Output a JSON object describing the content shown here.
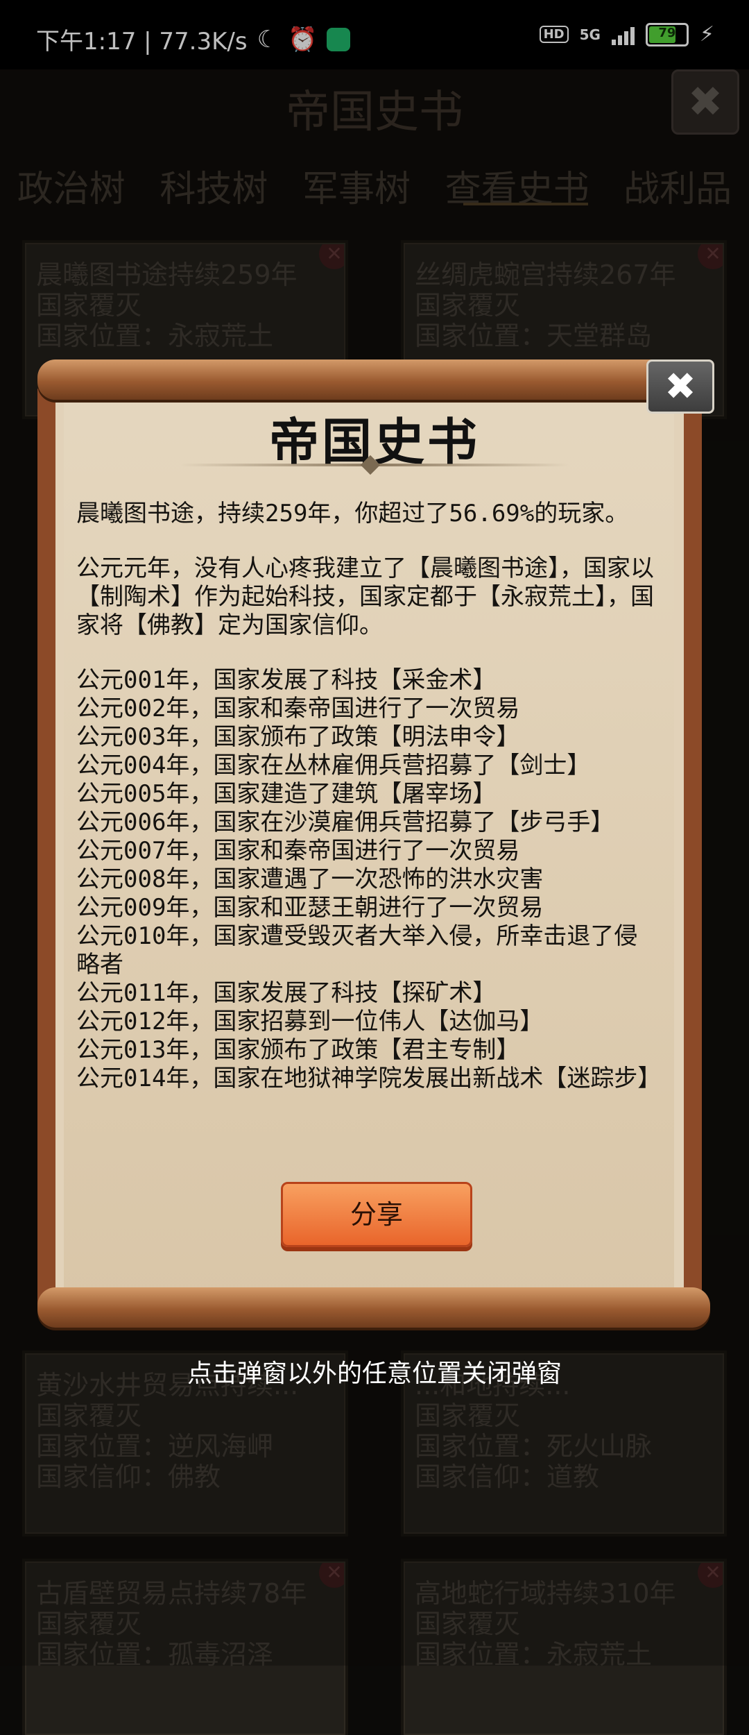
{
  "status_bar": {
    "time_speed": "下午1:17 | 77.3K/s",
    "hd": "HD",
    "signal": "5G",
    "battery": "79",
    "battery_level": 0.79
  },
  "background": {
    "title": "帝国史书",
    "tabs": [
      "政治树",
      "科技树",
      "军事树",
      "查看史书",
      "战利品"
    ],
    "active_tab": "查看史书",
    "cards": [
      {
        "line1": "晨曦图书途持续259年",
        "line2": "国家覆灭",
        "line3": "国家位置：永寂荒土"
      },
      {
        "line1": "丝绸虎蜿宫持续267年",
        "line2": "国家覆灭",
        "line3": "国家位置：天堂群岛"
      },
      {
        "line1": "黄沙水井贸易点持续...",
        "line2": "国家覆灭",
        "line3": "国家位置：逆风海岬",
        "line4": "国家信仰：佛教"
      },
      {
        "line1": "...和地持续...",
        "line2": "国家覆灭",
        "line3": "国家位置：死火山脉",
        "line4": "国家信仰：道教"
      },
      {
        "line1": "古盾壁贸易点持续78年",
        "line2": "国家覆灭",
        "line3": "国家位置：孤毒沼泽"
      },
      {
        "line1": "高地蛇行域持续310年",
        "line2": "国家覆灭",
        "line3": "国家位置：永寂荒土"
      }
    ]
  },
  "modal": {
    "title": "帝国史书",
    "summary": "晨曦图书途，持续259年，你超过了56.69%的玩家。",
    "founding": "公元元年，没有人心疼我建立了【晨曦图书途】，国家以【制陶术】作为起始科技，国家定都于【永寂荒土】，国家将【佛教】定为国家信仰。",
    "events": [
      "公元001年，国家发展了科技【采金术】",
      "公元002年，国家和秦帝国进行了一次贸易",
      "公元003年，国家颁布了政策【明法申令】",
      "公元004年，国家在丛林雇佣兵营招募了【剑士】",
      "公元005年，国家建造了建筑【屠宰场】",
      "公元006年，国家在沙漠雇佣兵营招募了【步弓手】",
      "公元007年，国家和秦帝国进行了一次贸易",
      "公元008年，国家遭遇了一次恐怖的洪水灾害",
      "公元009年，国家和亚瑟王朝进行了一次贸易",
      "公元010年，国家遭受毁灭者大举入侵，所幸击退了侵略者",
      "公元011年，国家发展了科技【探矿术】",
      "公元012年，国家招募到一位伟人【达伽马】",
      "公元013年，国家颁布了政策【君主专制】",
      "公元014年，国家在地狱神学院发展出新战术【迷踪步】"
    ],
    "share_label": "分享",
    "close_label": "✖"
  },
  "hint": "点击弹窗以外的任意位置关闭弹窗"
}
